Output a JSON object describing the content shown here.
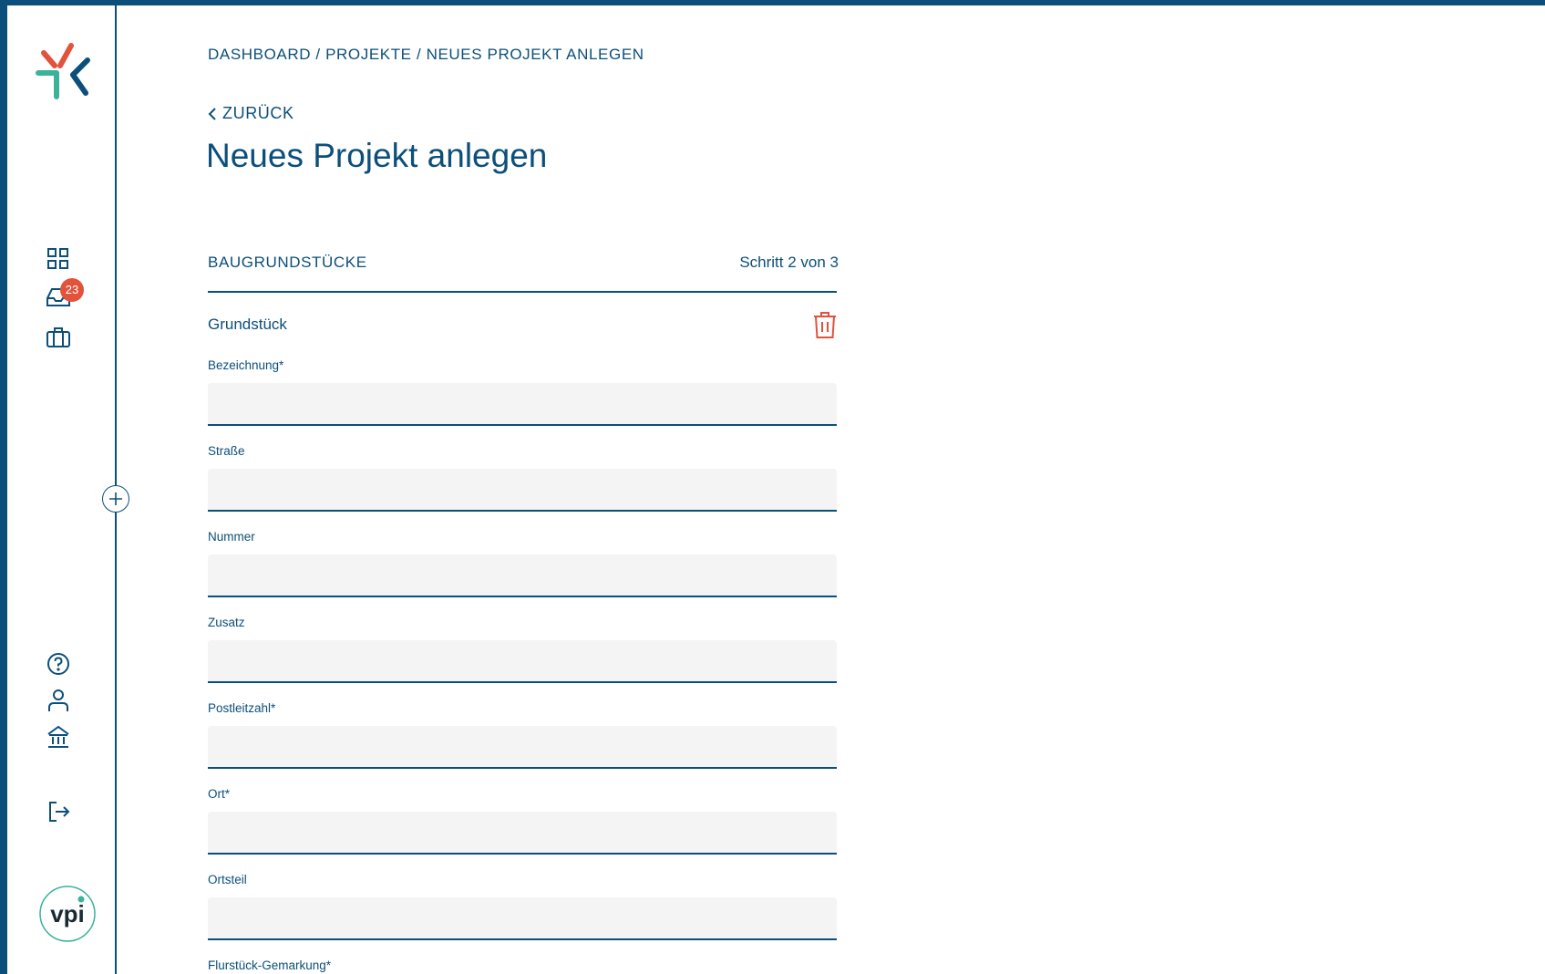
{
  "colors": {
    "primary": "#0b4f7a",
    "accent": "#e2533c",
    "teal": "#3bb39a",
    "input_bg": "#f4f4f4"
  },
  "sidebar": {
    "logo_icon": "brand-logo-icon",
    "nav": [
      {
        "icon": "dashboard-grid-icon"
      },
      {
        "icon": "inbox-icon",
        "badge": "23"
      },
      {
        "icon": "briefcase-icon"
      }
    ],
    "bottom": [
      {
        "icon": "help-icon"
      },
      {
        "icon": "user-icon"
      },
      {
        "icon": "bank-icon"
      },
      {
        "icon": "logout-icon"
      }
    ],
    "collapse_icon": "plus-circle-icon",
    "footer_logo_text": "vpi"
  },
  "breadcrumb": {
    "items": [
      "DASHBOARD",
      "PROJEKTE",
      "NEUES PROJEKT ANLEGEN"
    ],
    "separator": " / "
  },
  "back_label": "ZURÜCK",
  "page_title": "Neues Projekt anlegen",
  "section": {
    "title": "BAUGRUNDSTÜCKE",
    "step": "Schritt 2 von 3"
  },
  "subsection": {
    "title": "Grundstück",
    "delete_icon": "trash-icon"
  },
  "fields": [
    {
      "label": "Bezeichnung*",
      "value": ""
    },
    {
      "label": "Straße",
      "value": ""
    },
    {
      "label": "Nummer",
      "value": ""
    },
    {
      "label": "Zusatz",
      "value": ""
    },
    {
      "label": "Postleitzahl*",
      "value": ""
    },
    {
      "label": "Ort*",
      "value": ""
    },
    {
      "label": "Ortsteil",
      "value": ""
    },
    {
      "label": "Flurstück-Gemarkung*",
      "value": ""
    }
  ]
}
